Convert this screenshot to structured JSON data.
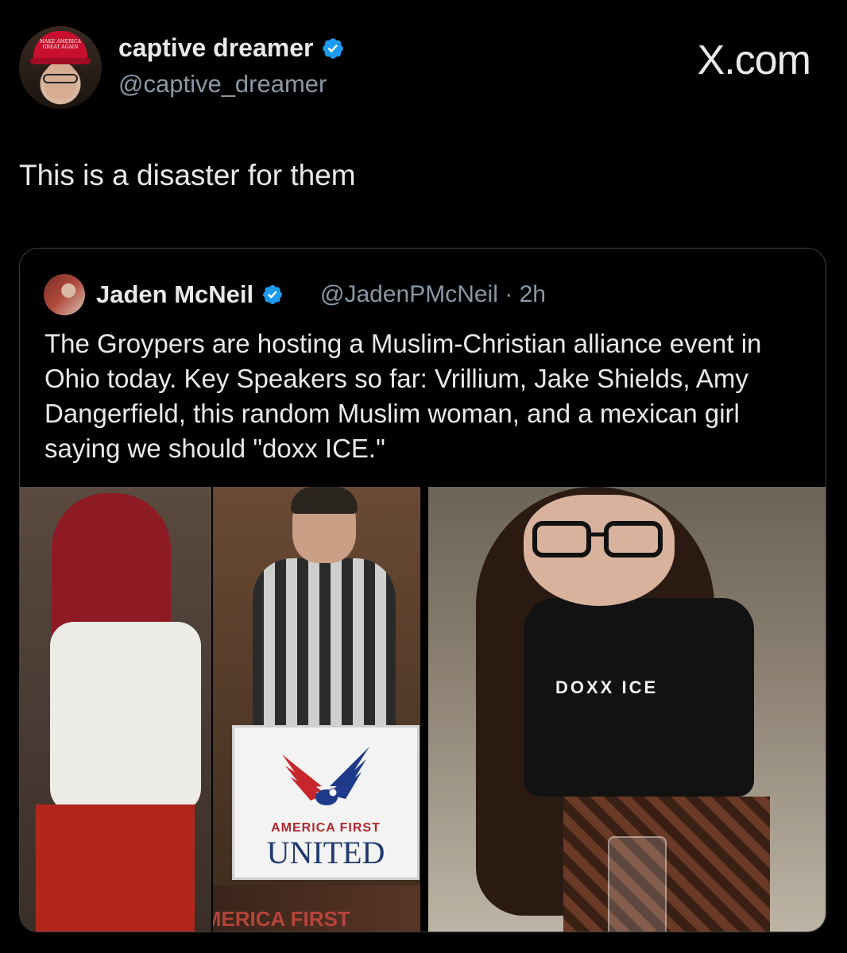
{
  "tweet": {
    "author": {
      "display_name": "captive dreamer",
      "handle": "@captive_dreamer",
      "verified": true,
      "avatar_hat_text": "MAKE AMERICA GREAT AGAIN"
    },
    "source_logo": "X.com",
    "text": "This is a disaster for them"
  },
  "quote": {
    "author": {
      "display_name": "Jaden McNeil",
      "handle": "@JadenPMcNeil",
      "separator": "·",
      "time": "2h",
      "verified": true
    },
    "text": "The Groypers are hosting a Muslim-Christian alliance event in Ohio today. Key Speakers so far: Vrillium, Jake Shields, Amy Dangerfield, this random Muslim woman, and a mexican girl saying we should \"doxx ICE.\"",
    "media": {
      "podium_small": "AMERICA FIRST",
      "podium_big": "UNITED",
      "banner_text": "AMERICA FIRST",
      "shirt_text": "DOXX ICE"
    }
  },
  "colors": {
    "background": "#000000",
    "text_primary": "#e7e9ea",
    "text_secondary": "#8b98a5",
    "verified_blue": "#1d9bf0",
    "border": "#3a3e42"
  },
  "icons": [
    "verified-badge-icon",
    "x-logo"
  ]
}
